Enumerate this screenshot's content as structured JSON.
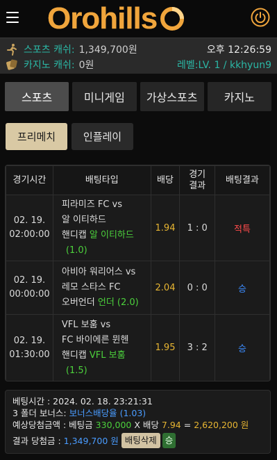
{
  "header": {
    "logo_text": "Orohills",
    "menu_icon": "hamburger-menu-icon",
    "power_icon": "power-icon"
  },
  "info": {
    "sports_cash_label": "스포츠 캐쉬:",
    "sports_cash_value": "1,349,700원",
    "casino_cash_label": "카지노 캐쉬:",
    "casino_cash_value": "0원",
    "time": "오후 12:26:59",
    "level": "레벨:LV. 1 / kkhyun9"
  },
  "tabs": [
    {
      "label": "스포츠",
      "active": true
    },
    {
      "label": "미니게임",
      "active": false
    },
    {
      "label": "가상스포츠",
      "active": false
    },
    {
      "label": "카지노",
      "active": false
    }
  ],
  "subtabs": [
    {
      "label": "프리메치",
      "active": true
    },
    {
      "label": "인플레이",
      "active": false
    }
  ],
  "table": {
    "headers": {
      "time": "경기시간",
      "bet_type": "배팅타입",
      "odds": "배당",
      "result_line1": "경기",
      "result_line2": "결과",
      "bet_result": "배팅결과"
    },
    "rows": [
      {
        "date": "02. 19.",
        "time": "02:00:00",
        "teams_line1": "피라미즈 FC vs",
        "teams_line2": "알 이티하드",
        "bet_label": "핸디캡",
        "bet_pick": "알 이티하드",
        "bet_extra": "(1.0)",
        "odds": "1.94",
        "score": "1 : 0",
        "result": "적특"
      },
      {
        "date": "02. 19.",
        "time": "00:00:00",
        "teams_line1": "아비아 워리어스 vs",
        "teams_line2": "레모 스타스 FC",
        "bet_label": "오버언더",
        "bet_pick": "언더 (2.0)",
        "bet_extra": "",
        "odds": "2.04",
        "score": "0 : 0",
        "result": "승"
      },
      {
        "date": "02. 19.",
        "time": "01:30:00",
        "teams_line1": "VFL 보훔 vs",
        "teams_line2": "FC 바이에른 뮌헨",
        "bet_label": "핸디캡",
        "bet_pick": "VFL 보훔",
        "bet_extra": "(1.5)",
        "odds": "1.95",
        "score": "3 : 2",
        "result": "승"
      }
    ]
  },
  "summary": {
    "bet_time_label": "베팅시간 :",
    "bet_time_value": "2024. 02. 18. 23:21:31",
    "bonus_label": "3 폴더 보너스:",
    "bonus_value": "보너스배당율 (1.03)",
    "expected_label": "예상당첨금액 :",
    "bet_amount_label": "베팅금",
    "bet_amount_value": "330,000",
    "times": "X",
    "odds_label": "배당",
    "odds_value": "7.94",
    "equals": "=",
    "expected_value": "2,620,200 원",
    "result_label": "결과 당첨금 :",
    "result_value": "1,349,700 원",
    "delete_button": "배팅삭제",
    "win_badge": "승"
  },
  "colors": {
    "logo": "#f0a53c",
    "teal": "#2bb8a6",
    "green": "#4cd13c",
    "yellow": "#e7b532",
    "red": "#ff4b4b",
    "blue": "#3c8cff"
  }
}
